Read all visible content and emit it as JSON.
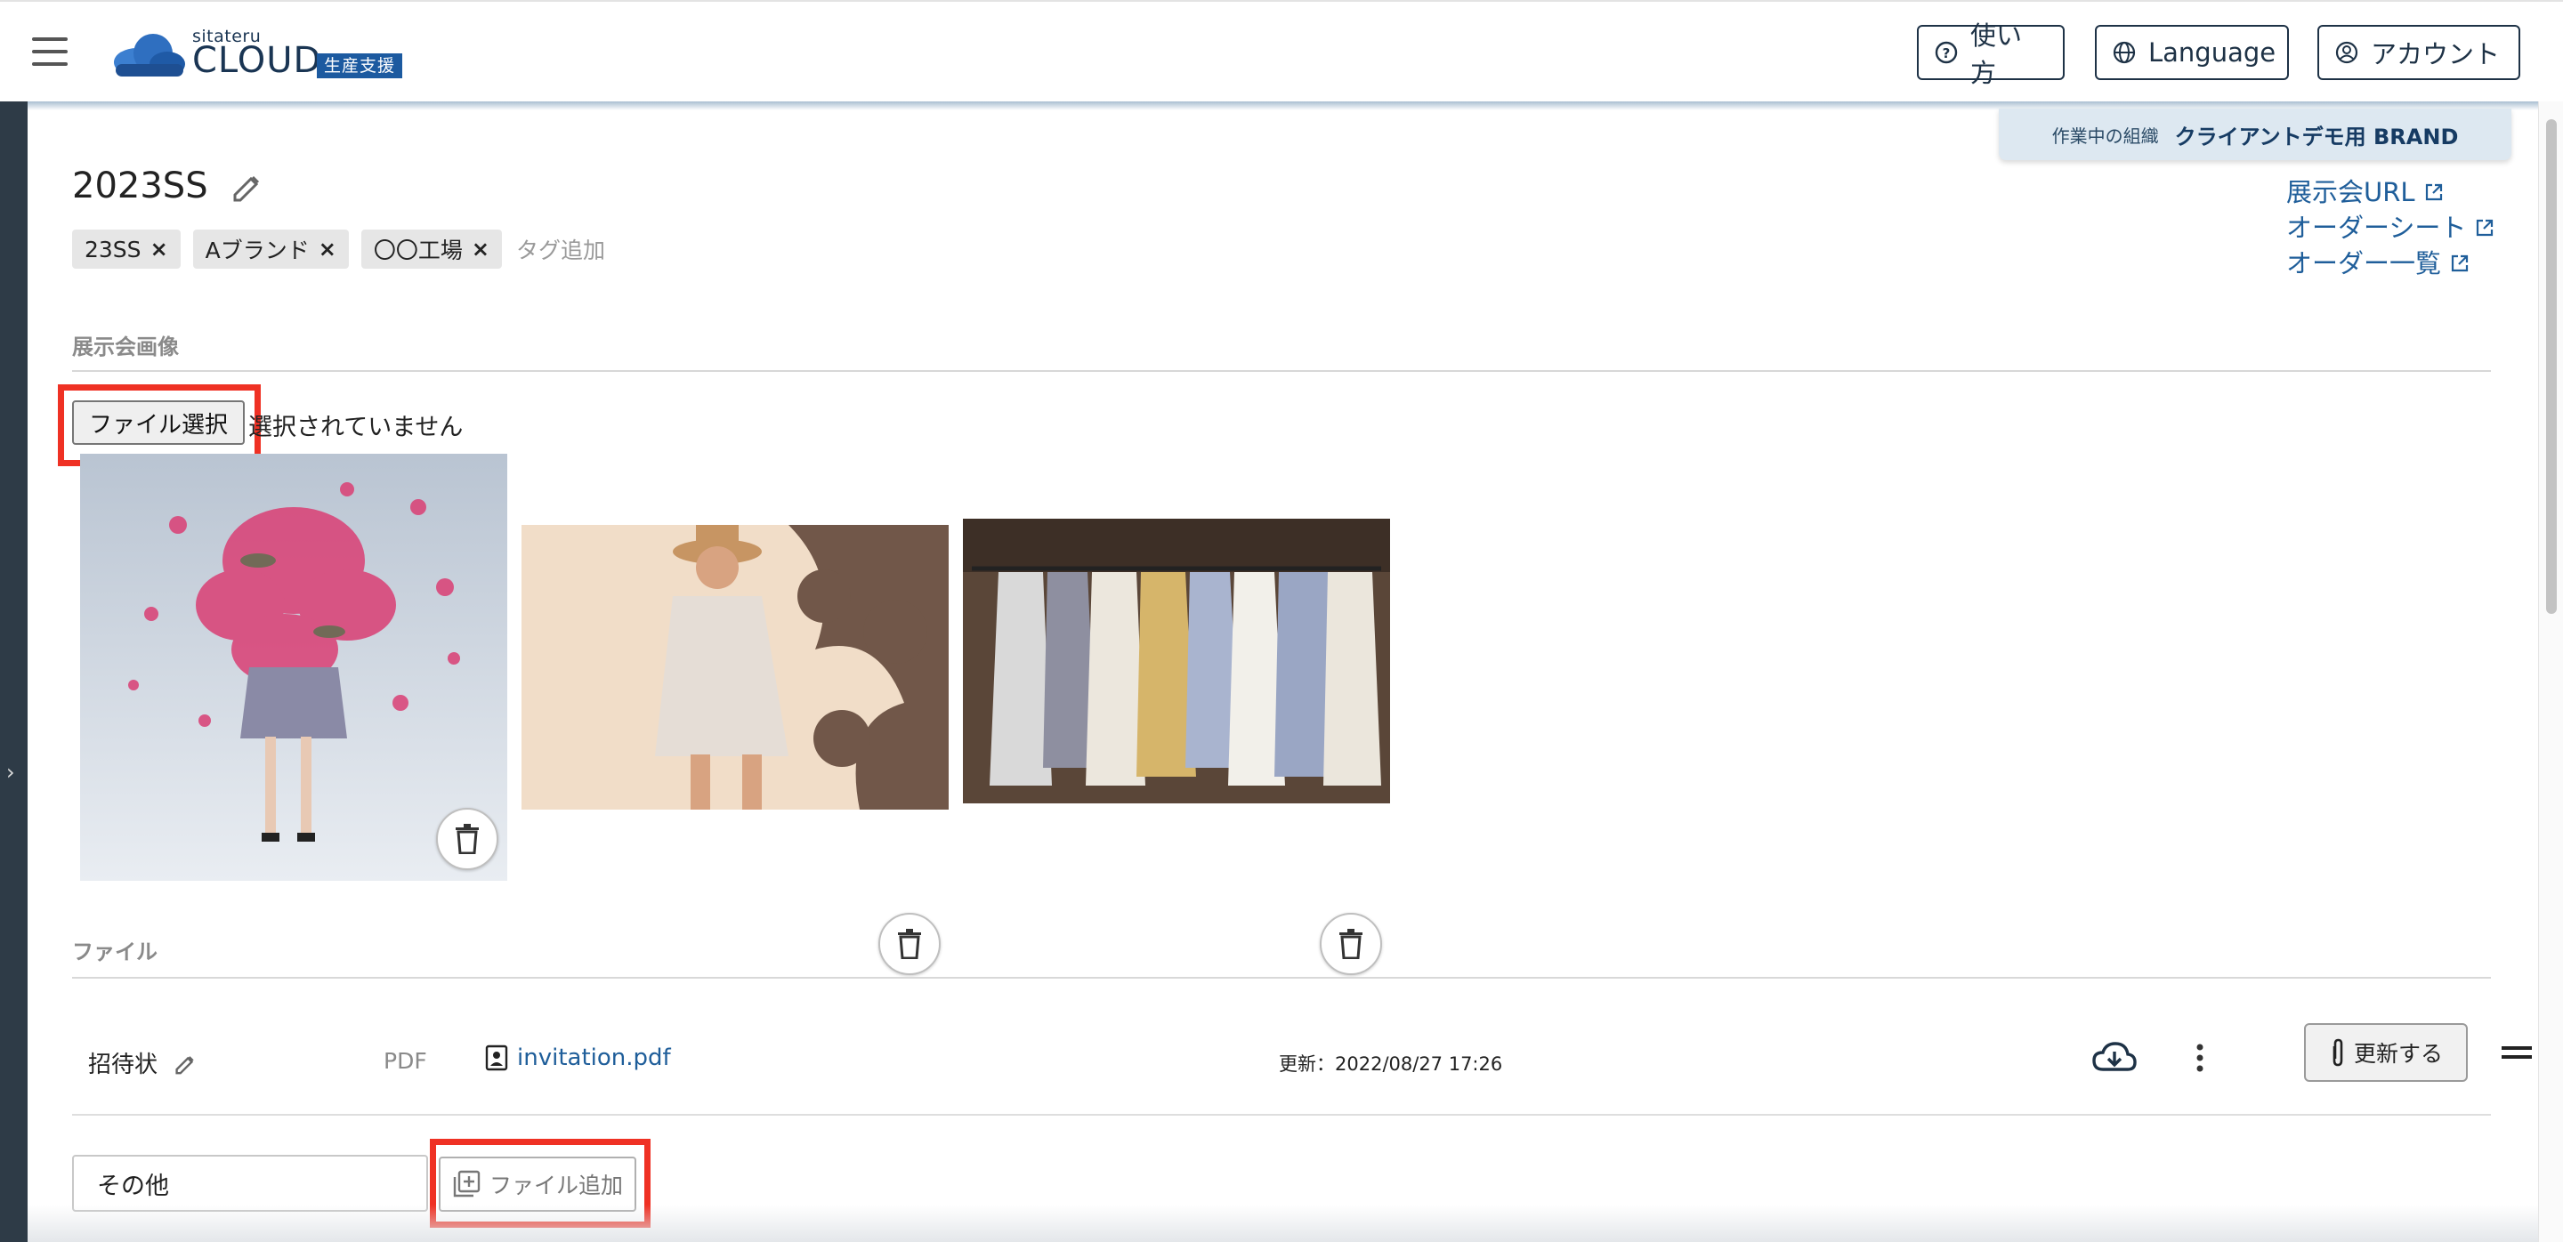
{
  "header": {
    "logo_small": "sitateru",
    "logo_big": "CLOUD",
    "logo_badge": "生産支援",
    "help_label": "使い方",
    "language_label": "Language",
    "account_label": "アカウント"
  },
  "org": {
    "label": "作業中の組織",
    "value": "クライアントデモ用 BRAND"
  },
  "project": {
    "title": "2023SS",
    "tags": [
      "23SS",
      "Aブランド",
      "〇〇工場"
    ],
    "tag_add_placeholder": "タグ追加"
  },
  "links": [
    "展示会URL",
    "オーダーシート",
    "オーダー一覧"
  ],
  "images_section": {
    "label": "展示会画像",
    "choose_button": "ファイル選択",
    "no_file_text": "選択されていません"
  },
  "files_section": {
    "label": "ファイル",
    "rows": [
      {
        "name": "招待状",
        "type": "PDF",
        "filename": "invitation.pdf",
        "updated": "更新：2022/08/27 17:26",
        "update_button": "更新する"
      }
    ]
  },
  "add_file": {
    "category_value": "その他",
    "button_label": "ファイル追加"
  },
  "colors": {
    "accent_link": "#1f5e9a",
    "highlight_red": "#ef3124",
    "navy": "#1e3246"
  }
}
